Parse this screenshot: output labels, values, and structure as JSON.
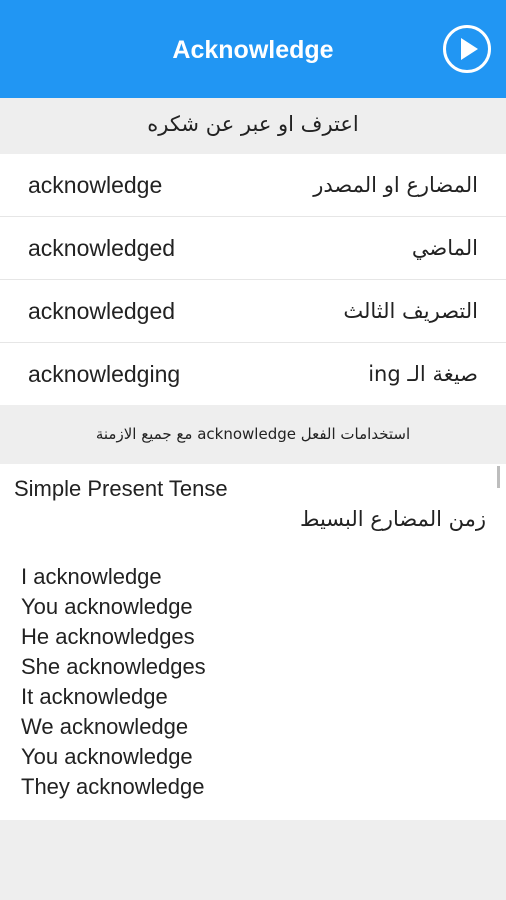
{
  "header": {
    "title": "Acknowledge",
    "play_icon": "play-circle-icon",
    "background_color": "#2196f3"
  },
  "translation": "اعترف او عبر عن شكره",
  "forms": [
    {
      "en": "acknowledge",
      "ar": "المضارع او المصدر"
    },
    {
      "en": "acknowledged",
      "ar": "الماضي"
    },
    {
      "en": "acknowledged",
      "ar": "التصريف الثالث"
    },
    {
      "en": "acknowledging",
      "ar": "صيغة الـ ing"
    }
  ],
  "usage_title": "استخدامات الفعل acknowledge مع جميع الازمنة",
  "tense": {
    "en": "Simple Present Tense",
    "ar": "زمن المضارع البسيط",
    "lines": [
      "I acknowledge",
      "You acknowledge",
      "He acknowledges",
      "She acknowledges",
      "It acknowledge",
      "We acknowledge",
      "You acknowledge",
      "They acknowledge"
    ]
  }
}
